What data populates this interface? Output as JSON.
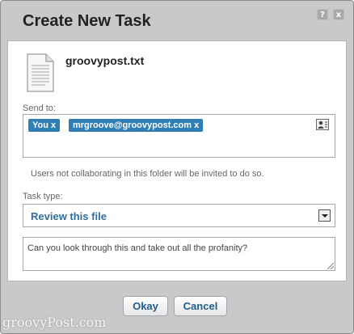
{
  "dialog": {
    "title": "Create New Task",
    "help_glyph": "?",
    "close_glyph": "x"
  },
  "file": {
    "icon": "document-icon",
    "name": "groovypost.txt"
  },
  "send_to": {
    "label": "Send to:",
    "recipients": [
      "You x",
      "mrgroove@groovypost.com x"
    ],
    "icon": "contacts-icon"
  },
  "notice": "Users not collaborating in this folder will be invited to do so.",
  "task_type": {
    "label": "Task type:",
    "selected": "Review this file"
  },
  "message": {
    "value": "Can you look through this and take out all the profanity?"
  },
  "buttons": {
    "ok": "Okay",
    "cancel": "Cancel"
  },
  "watermark": "groovyPost.com",
  "colors": {
    "accent": "#2f7fb5",
    "link_text": "#1f5f8f",
    "frame": "#c9c9c9"
  }
}
